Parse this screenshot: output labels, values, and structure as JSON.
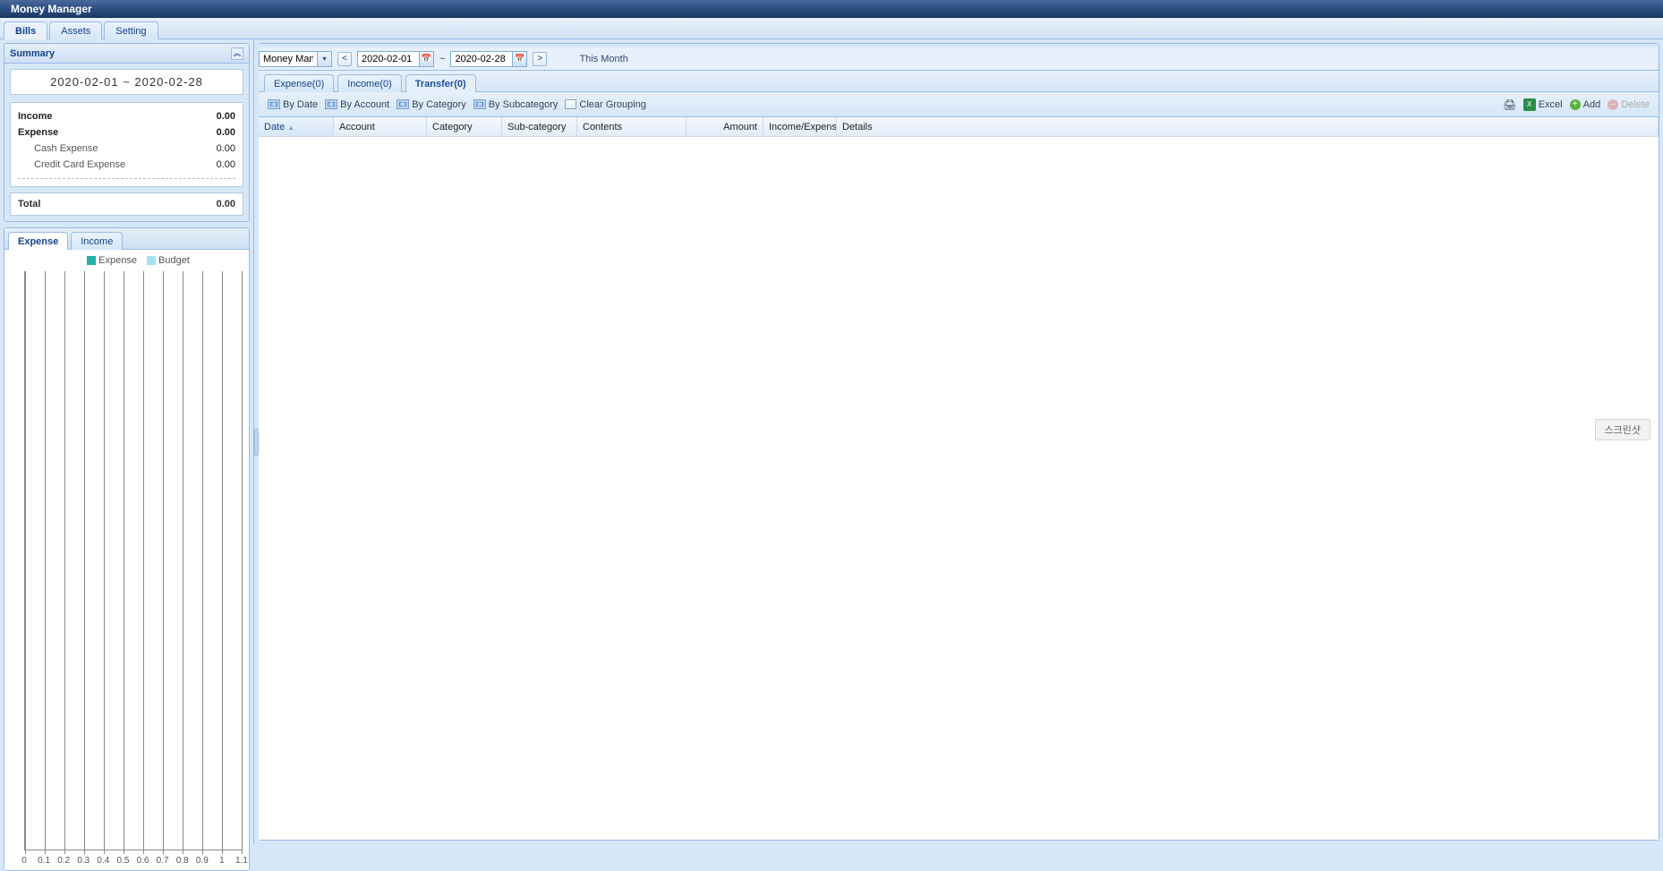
{
  "app": {
    "title": "Money Manager"
  },
  "main_tabs": {
    "bills": "Bills",
    "assets": "Assets",
    "setting": "Setting",
    "active": "bills"
  },
  "summary": {
    "header": "Summary",
    "date_range": "2020-02-01  ~  2020-02-28",
    "rows": {
      "income": {
        "label": "Income",
        "value": "0.00"
      },
      "expense": {
        "label": "Expense",
        "value": "0.00"
      },
      "cash": {
        "label": "Cash Expense",
        "value": "0.00"
      },
      "credit": {
        "label": "Credit Card Expense",
        "value": "0.00"
      }
    },
    "total": {
      "label": "Total",
      "value": "0.00"
    }
  },
  "chart_tabs": {
    "expense": "Expense",
    "income": "Income",
    "active": "expense"
  },
  "chart_legend": {
    "a": "Expense",
    "b": "Budget"
  },
  "chart_data": {
    "type": "bar",
    "categories": [
      "0",
      "0.1",
      "0.2",
      "0.3",
      "0.4",
      "0.5",
      "0.6",
      "0.7",
      "0.8",
      "0.9",
      "1",
      "1.1"
    ],
    "series": [
      {
        "name": "Expense",
        "values": [
          0,
          0,
          0,
          0,
          0,
          0,
          0,
          0,
          0,
          0,
          0,
          0
        ]
      },
      {
        "name": "Budget",
        "values": [
          0,
          0,
          0,
          0,
          0,
          0,
          0,
          0,
          0,
          0,
          0,
          0
        ]
      }
    ],
    "xlabel": "",
    "ylabel": "",
    "xlim": [
      0,
      1.1
    ],
    "ylim": [
      0,
      0
    ],
    "colors": {
      "Expense": "#1eb1a8",
      "Budget": "#a6dff1"
    }
  },
  "filter": {
    "account": "Money Manager",
    "date_from": "2020-02-01",
    "date_to": "2020-02-28",
    "sep": "~",
    "prev": "<",
    "next": ">",
    "period_label": "This Month"
  },
  "sub_tabs": {
    "expense": "Expense(0)",
    "income": "Income(0)",
    "transfer": "Transfer(0)",
    "active": "transfer"
  },
  "toolbar": {
    "by_date": "By Date",
    "by_account": "By Account",
    "by_category": "By Category",
    "by_subcategory": "By Subcategory",
    "clear_grouping": "Clear Grouping",
    "excel": "Excel",
    "add": "Add",
    "delete": "Delete"
  },
  "columns": {
    "date": "Date",
    "account": "Account",
    "category": "Category",
    "subcategory": "Sub-category",
    "contents": "Contents",
    "amount": "Amount",
    "income_expense": "Income/Expense",
    "details": "Details"
  },
  "float_label": "스크린샷"
}
